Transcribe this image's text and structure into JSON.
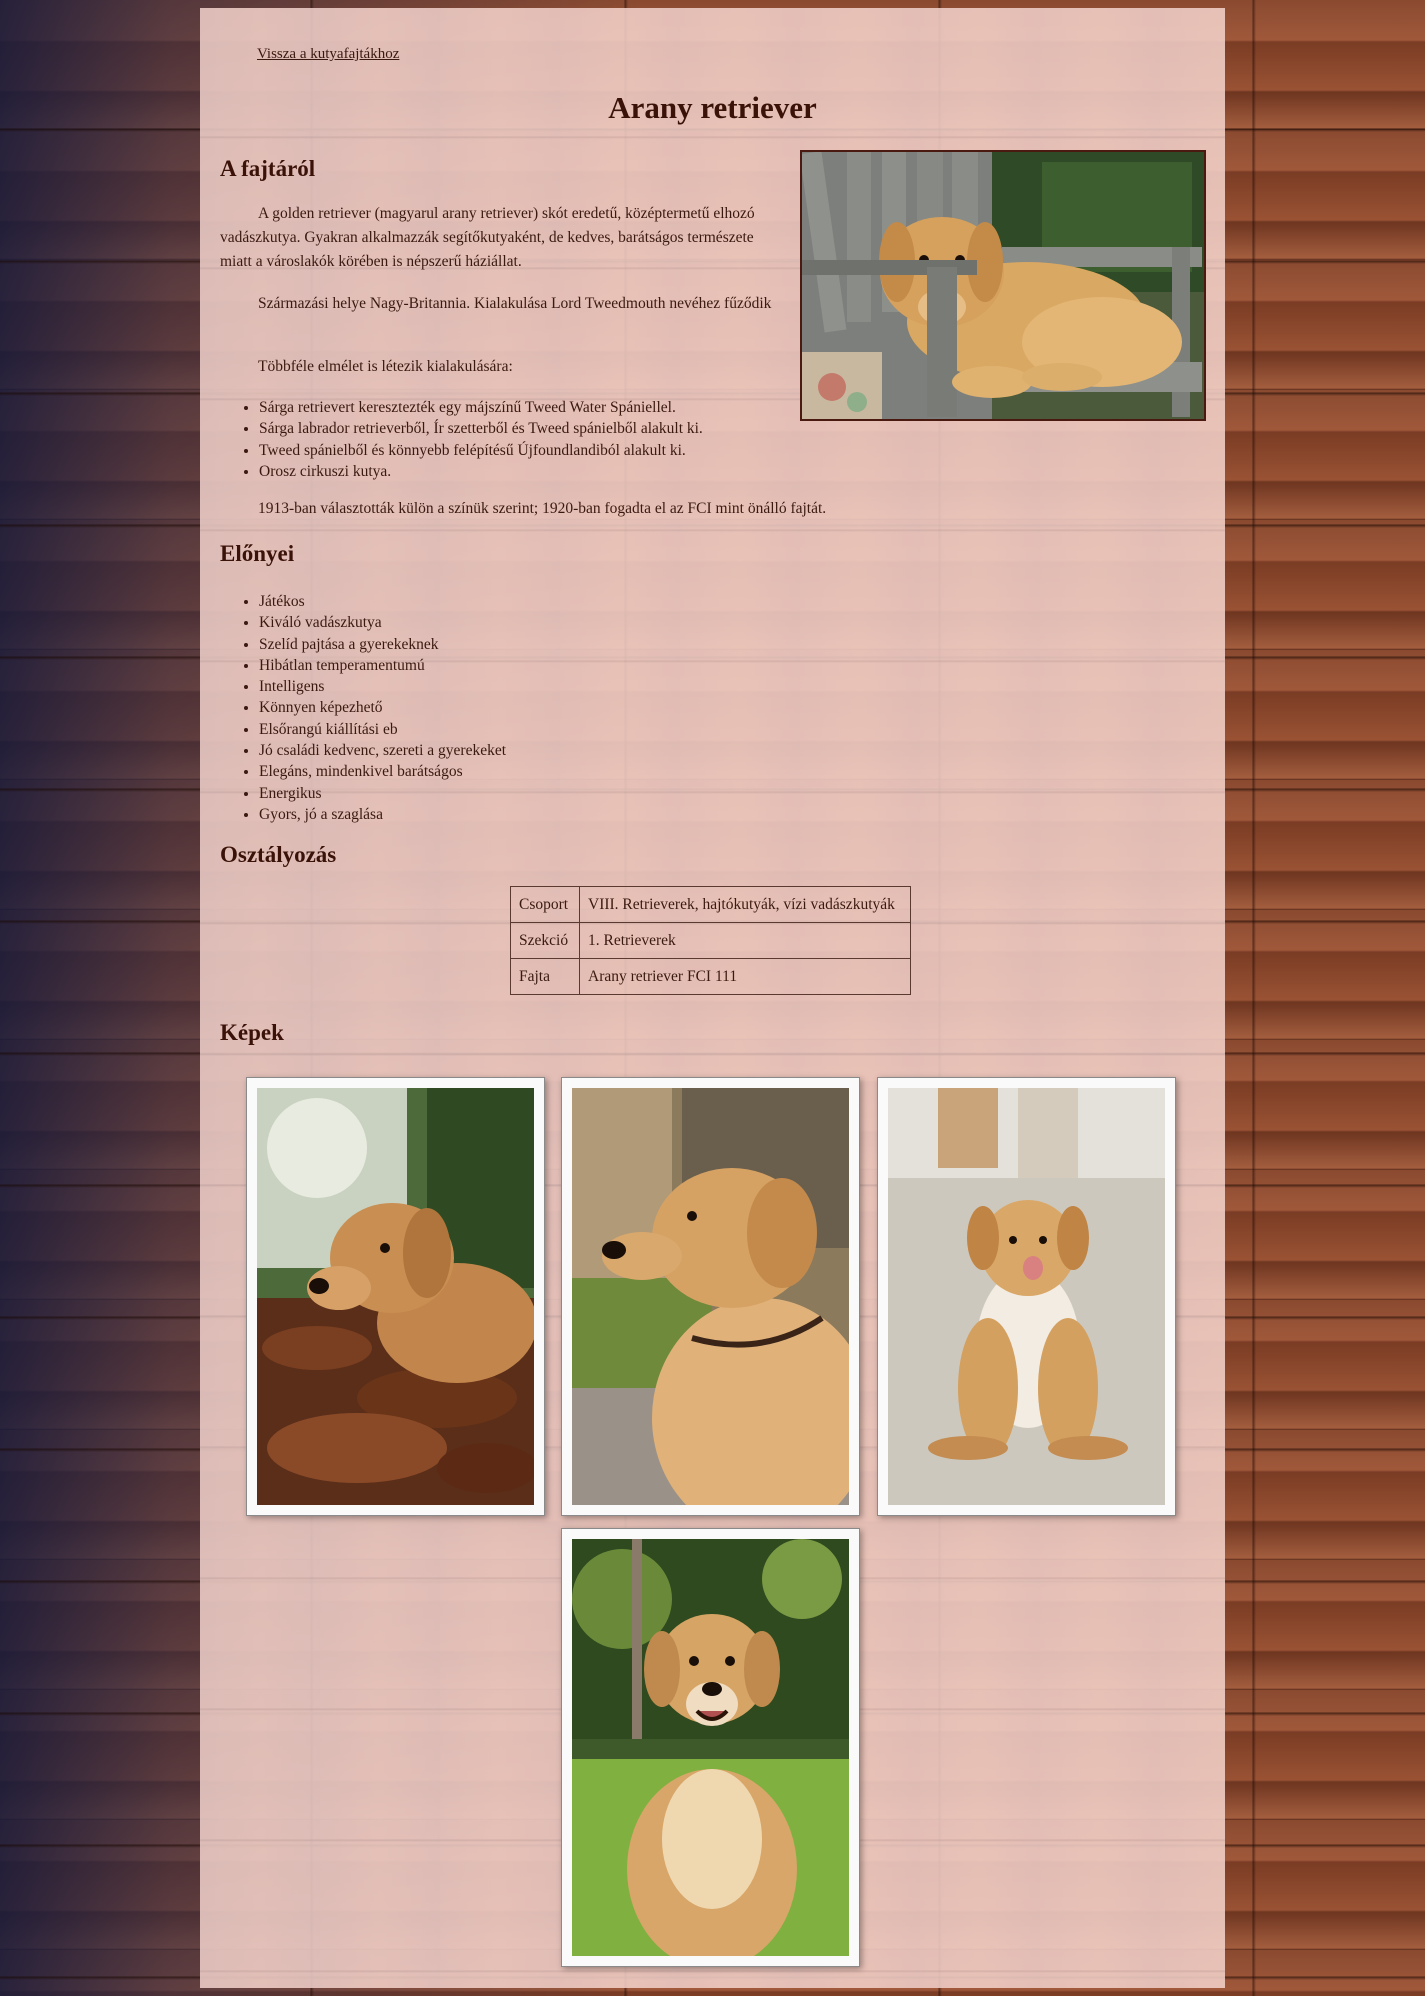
{
  "nav": {
    "back_link": "Vissza a kutyafajtákhoz"
  },
  "page": {
    "title": "Arany retriever"
  },
  "about": {
    "heading": "A fajtáról",
    "p1": "A golden retriever (magyarul arany retriever) skót eredetű, középtermetű elhozó vadászkutya. Gyakran alkalmazzák segítőkutyaként, de kedves, barátságos természete miatt a városlakók körében is népszerű háziállat.",
    "p2": "Származási helye Nagy-Britannia. Kialakulása Lord Tweedmouth nevéhez fűződik",
    "p3": "Többféle elmélet is létezik kialakulására:",
    "theories": [
      "Sárga retrievert keresztezték egy májszínű Tweed Water Spániellel.",
      "Sárga labrador retrieverből, Ír szetterből és Tweed spánielből alakult ki.",
      "Tweed spánielből és könnyebb felépítésű Újfoundlandiból alakult ki.",
      "Orosz cirkuszi kutya."
    ],
    "p4": "1913-ban választották külön a színük szerint; 1920-ban fogadta el az FCI mint önálló fajtát."
  },
  "advantages": {
    "heading": "Előnyei",
    "items": [
      "Játékos",
      "Kiváló vadászkutya",
      "Szelíd pajtása a gyerekeknek",
      "Hibátlan temperamentumú",
      "Intelligens",
      "Könnyen képezhető",
      "Elsőrangú kiállítási eb",
      "Jó családi kedvenc, szereti a gyerekeket",
      "Elegáns, mindenkivel barátságos",
      "Energikus",
      "Gyors, jó a szaglása"
    ]
  },
  "classification": {
    "heading": "Osztályozás",
    "rows": [
      {
        "key": "Csoport",
        "value": "VIII. Retrieverek, hajtókutyák, vízi vadászkutyák"
      },
      {
        "key": "Szekció",
        "value": "1. Retrieverek"
      },
      {
        "key": "Fajta",
        "value": "Arany retriever FCI 111"
      }
    ]
  },
  "gallery": {
    "heading": "Képek"
  },
  "colors": {
    "text": "#3a1a10",
    "sheet": "#f6d4cc",
    "dog_gold": "#d8a160"
  }
}
